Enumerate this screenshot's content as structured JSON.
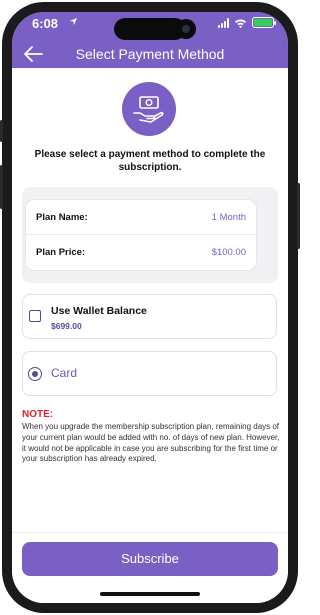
{
  "status_bar": {
    "time": "6:08",
    "battery_color": "#30d158"
  },
  "header": {
    "title": "Select Payment Method",
    "back_icon": "back-arrow-icon"
  },
  "theme": {
    "accent": "#7a5fc5",
    "note_color": "#e0242b"
  },
  "intro_text": "Please select a payment method to complete the subscription.",
  "plan": {
    "name_label": "Plan Name:",
    "name_value": "1 Month",
    "price_label": "Plan Price:",
    "price_value": "$100.00"
  },
  "payment_options": {
    "wallet": {
      "label": "Use Wallet Balance",
      "amount": "$699.00",
      "checked": false
    },
    "card": {
      "label": "Card",
      "selected": true
    }
  },
  "note": {
    "title": "NOTE:",
    "text": "When you upgrade the membership subscription plan, remaining days of your current plan would be added with no. of days of new plan. However, it would not be applicable in case you are subscribing for the first time or your subscription has already expired."
  },
  "actions": {
    "subscribe_label": "Subscribe"
  }
}
